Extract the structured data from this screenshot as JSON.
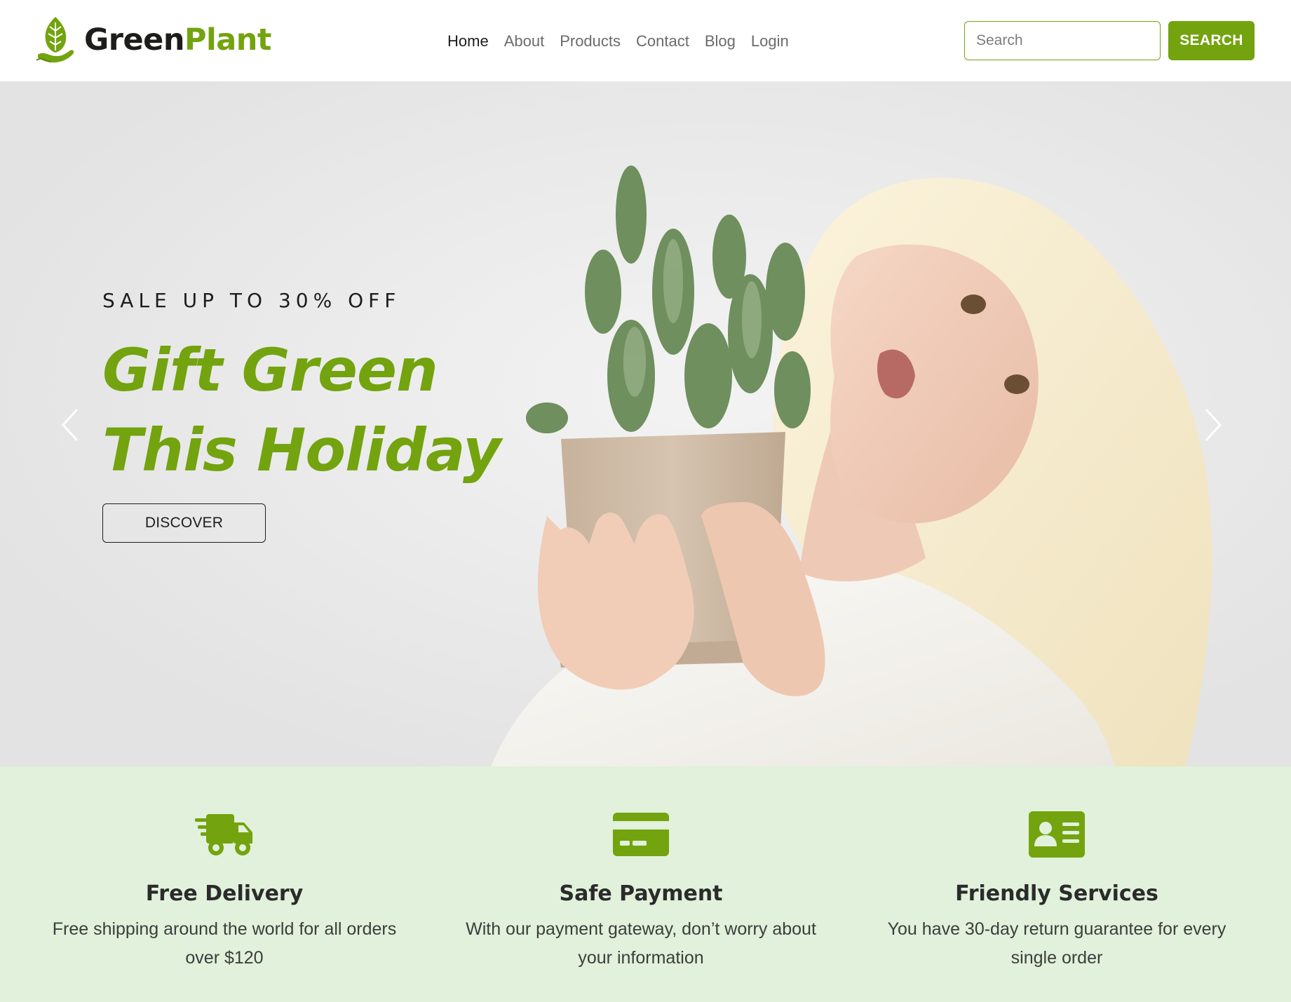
{
  "brand": {
    "part1": "Green",
    "part2": "Plant",
    "icon": "leaf-hand-icon"
  },
  "nav": {
    "items": [
      {
        "label": "Home",
        "active": true
      },
      {
        "label": "About",
        "active": false
      },
      {
        "label": "Products",
        "active": false
      },
      {
        "label": "Contact",
        "active": false
      },
      {
        "label": "Blog",
        "active": false
      },
      {
        "label": "Login",
        "active": false
      }
    ]
  },
  "search": {
    "placeholder": "Search",
    "value": "",
    "button_label": "SEARCH"
  },
  "hero": {
    "eyebrow": "SALE UP TO 30% OFF",
    "headline_line1": "Gift Green",
    "headline_line2": "This Holiday",
    "cta_label": "DISCOVER",
    "prev_icon": "chevron-left-icon",
    "next_icon": "chevron-right-icon"
  },
  "features": [
    {
      "icon": "truck-fast-icon",
      "title": "Free Delivery",
      "line1": "Free shipping around the world for all orders",
      "line2": "over $120"
    },
    {
      "icon": "credit-card-icon",
      "title": "Safe Payment",
      "line1": "With our payment gateway, don’t worry about",
      "line2": "your information"
    },
    {
      "icon": "id-card-icon",
      "title": "Friendly Services",
      "line1": "You have 30-day return guarantee for every",
      "line2": "single order"
    }
  ],
  "colors": {
    "accent": "#73a30e",
    "features_bg": "#e1f1db",
    "text_dark": "#1d1d1b"
  }
}
